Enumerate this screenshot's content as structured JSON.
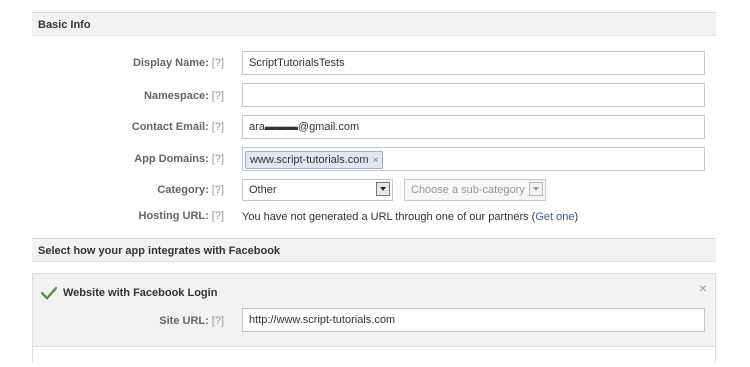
{
  "basic_info": {
    "header": "Basic Info",
    "help": "[?]",
    "display_name": {
      "label": "Display Name:",
      "value": "ScriptTutorialsTests"
    },
    "namespace": {
      "label": "Namespace:",
      "value": ""
    },
    "contact_email": {
      "label": "Contact Email:",
      "value": "ara▬▬▬@gmail.com"
    },
    "app_domains": {
      "label": "App Domains:",
      "tokens": [
        "www.script-tutorials.com"
      ],
      "remove": "×"
    },
    "category": {
      "label": "Category:",
      "value": "Other",
      "sub_placeholder": "Choose a sub-category"
    },
    "hosting_url": {
      "label": "Hosting URL:",
      "text": "You have not generated a URL through one of our partners (",
      "link": "Get one",
      "text_end": ")"
    }
  },
  "integration": {
    "header": "Select how your app integrates with Facebook",
    "website_login": {
      "title": "Website with Facebook Login",
      "close": "×",
      "site_url": {
        "label": "Site URL:",
        "value": "http://www.script-tutorials.com"
      }
    }
  },
  "colors": {
    "accent": "#3b5998",
    "check": "#5aa24a"
  }
}
